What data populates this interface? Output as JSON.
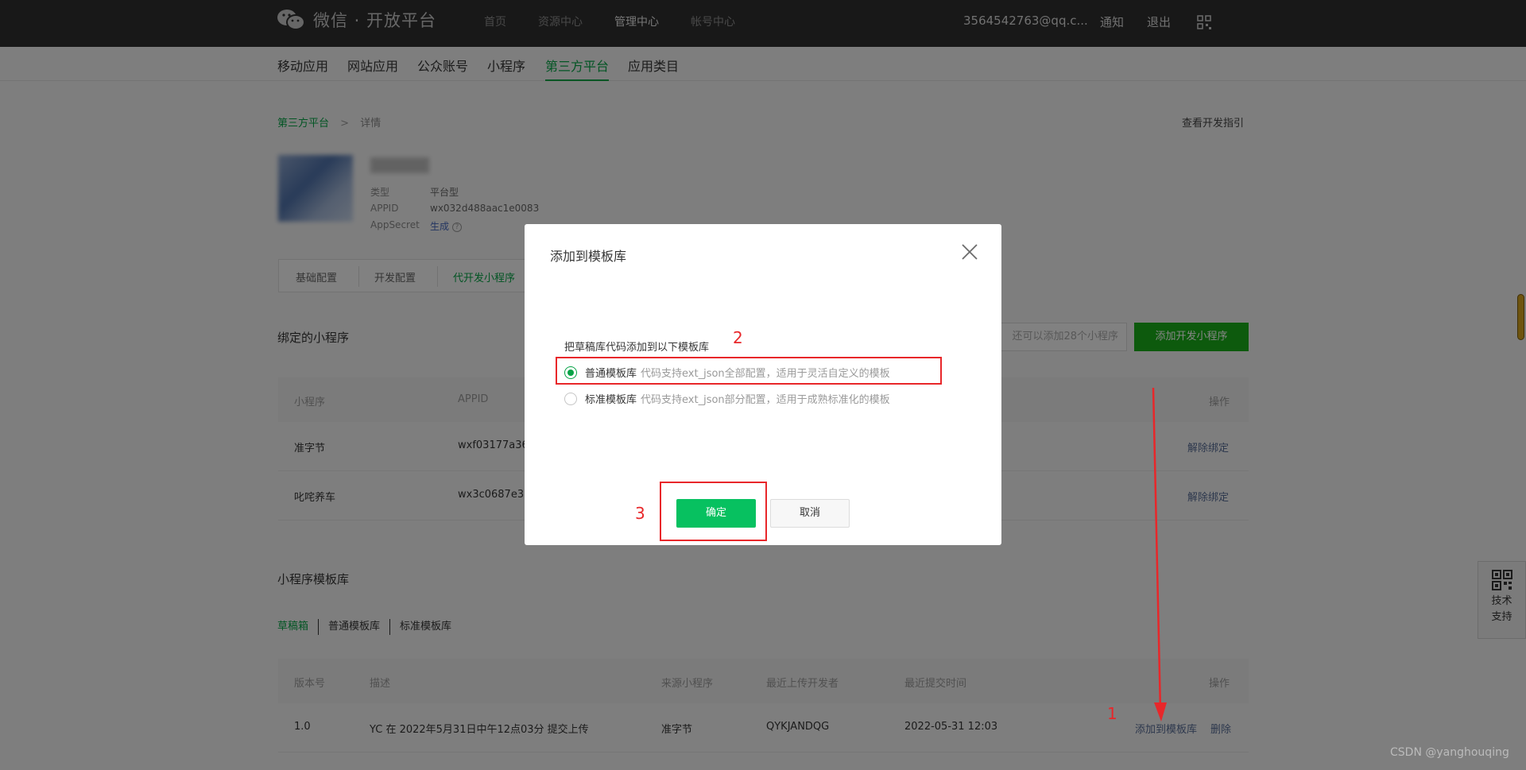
{
  "header": {
    "logo_text": "微信 · 开放平台",
    "nav": [
      "首页",
      "资源中心",
      "管理中心",
      "帐号中心"
    ],
    "account": "3564542763@qq.c...",
    "notify": "通知",
    "logout": "退出"
  },
  "subnav": [
    "移动应用",
    "网站应用",
    "公众账号",
    "小程序",
    "第三方平台",
    "应用类目"
  ],
  "breadcrumb": {
    "parent": "第三方平台",
    "separator": ">",
    "current": "详情"
  },
  "guide_link": "查看开发指引",
  "platform_info": {
    "type_label": "类型",
    "type_value": "平台型",
    "appid_label": "APPID",
    "appid_value": "wx032d488aac1e0083",
    "secret_label": "AppSecret",
    "secret_value": "生成",
    "help_icon": "?"
  },
  "config_tabs": [
    "基础配置",
    "开发配置",
    "代开发小程序"
  ],
  "bound": {
    "title": "绑定的小程序",
    "quota_text": "还可以添加28个小程序",
    "add_button": "添加开发小程序",
    "columns": {
      "name": "小程序",
      "appid": "APPID",
      "op": "操作"
    },
    "rows": [
      {
        "name": "准字节",
        "appid": "wxf03177a36",
        "op": "解除绑定"
      },
      {
        "name": "叱咤养车",
        "appid": "wx3c0687e3",
        "op": "解除绑定"
      }
    ]
  },
  "templates": {
    "title": "小程序模板库",
    "tabs": [
      "草稿箱",
      "普通模板库",
      "标准模板库"
    ],
    "columns": {
      "version": "版本号",
      "desc": "描述",
      "source": "来源小程序",
      "dev": "最近上传开发者",
      "time": "最近提交时间",
      "op": "操作"
    },
    "row": {
      "version": "1.0",
      "desc": "YC 在 2022年5月31日中午12点03分 提交上传",
      "source": "准字节",
      "dev": "QYKJANDQG",
      "time": "2022-05-31 12:03",
      "add": "添加到模板库",
      "delete": "删除"
    }
  },
  "modal": {
    "title": "添加到模板库",
    "description": "把草稿库代码添加到以下模板库",
    "options": [
      {
        "name": "普通模板库",
        "hint": "代码支持ext_json全部配置，适用于灵活自定义的模板",
        "checked": true
      },
      {
        "name": "标准模板库",
        "hint": "代码支持ext_json部分配置，适用于成熟标准化的模板",
        "checked": false
      }
    ],
    "confirm": "确定",
    "cancel": "取消"
  },
  "annotations": [
    "1",
    "2",
    "3"
  ],
  "side_support": "技术支持",
  "watermark": "CSDN @yanghouqing",
  "colors": {
    "brand_green": "#07c160",
    "link_green": "#07a346",
    "annotation_red": "#e8272a",
    "topbar": "#2e2e2e"
  }
}
